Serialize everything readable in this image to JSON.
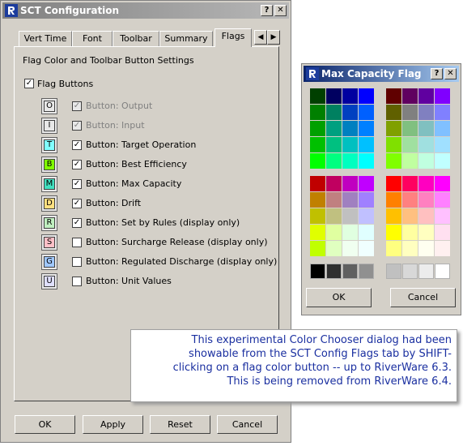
{
  "sct_window": {
    "title": "SCT Configuration",
    "help_btn": "?",
    "close_btn": "✕",
    "tabs": [
      "Vert Time",
      "Font",
      "Toolbar",
      "Summary",
      "Flags"
    ],
    "selected_tab": "Flags",
    "tab_scroll_left": "◀",
    "tab_scroll_right": "▶",
    "section_title": "Flag Color and Toolbar Button Settings",
    "flag_buttons_label": "Flag Buttons",
    "flag_buttons_checked": true,
    "flags": [
      {
        "letter": "O",
        "color": "#e8e8e8",
        "label": "Button: Output",
        "checked": true,
        "disabled": true
      },
      {
        "letter": "I",
        "color": "#e8e8e8",
        "label": "Button: Input",
        "checked": true,
        "disabled": true
      },
      {
        "letter": "T",
        "color": "#80ffff",
        "label": "Button: Target Operation",
        "checked": true,
        "disabled": false
      },
      {
        "letter": "B",
        "color": "#80ff00",
        "label": "Button: Best Efficiency",
        "checked": true,
        "disabled": false
      },
      {
        "letter": "M",
        "color": "#40e0c0",
        "label": "Button: Max Capacity",
        "checked": true,
        "disabled": false
      },
      {
        "letter": "D",
        "color": "#ffe080",
        "label": "Button: Drift",
        "checked": true,
        "disabled": false
      },
      {
        "letter": "R",
        "color": "#c0f0c0",
        "label": "Button: Set by Rules (display only)",
        "checked": true,
        "disabled": false
      },
      {
        "letter": "S",
        "color": "#ffc0c8",
        "label": "Button: Surcharge Release (display only)",
        "checked": false,
        "disabled": false
      },
      {
        "letter": "G",
        "color": "#a0c8ff",
        "label": "Button: Regulated Discharge (display only)",
        "checked": false,
        "disabled": false
      },
      {
        "letter": "U",
        "color": "#e0e0ff",
        "label": "Button: Unit Values",
        "checked": false,
        "disabled": false
      }
    ],
    "ok_label": "OK",
    "apply_label": "Apply",
    "reset_label": "Reset",
    "cancel_label": "Cancel"
  },
  "color_dialog": {
    "title": "Max Capacity Flag",
    "help_btn": "?",
    "close_btn": "✕",
    "ok_label": "OK",
    "cancel_label": "Cancel",
    "palettes": [
      [
        "#004000",
        "#000060",
        "#0000a0",
        "#0000ff",
        "#008000",
        "#008060",
        "#0040c0",
        "#0060ff",
        "#00a000",
        "#00a080",
        "#0080c0",
        "#0080ff",
        "#00c000",
        "#00c080",
        "#00c0c0",
        "#00c0ff",
        "#00ff00",
        "#00ff80",
        "#00ffc0",
        "#00ffff"
      ],
      [
        "#600000",
        "#600060",
        "#6000a0",
        "#8000ff",
        "#606000",
        "#808080",
        "#8080c0",
        "#8080ff",
        "#80a000",
        "#80c080",
        "#80c0c0",
        "#80c0ff",
        "#80e000",
        "#a0e0a0",
        "#a0e0e0",
        "#a0e0ff",
        "#80ff00",
        "#c0ffa0",
        "#c0ffe0",
        "#c0ffff"
      ],
      [
        "#c00000",
        "#c00060",
        "#c000c0",
        "#c000ff",
        "#c08000",
        "#c08080",
        "#a080c0",
        "#a080ff",
        "#c0c000",
        "#c0c080",
        "#c0c0c0",
        "#c0c0ff",
        "#e0ff00",
        "#e0ffa0",
        "#e0ffe0",
        "#e0ffff",
        "#c0ff00",
        "#e0ffc0",
        "#f0fff0",
        "#f0ffff"
      ],
      [
        "#ff0000",
        "#ff0060",
        "#ff00c0",
        "#ff00ff",
        "#ff8000",
        "#ff8080",
        "#ff80c0",
        "#ff80ff",
        "#ffc000",
        "#ffc080",
        "#ffc0c0",
        "#ffc0ff",
        "#ffff00",
        "#ffffa0",
        "#ffffc0",
        "#ffe0f0",
        "#ffff80",
        "#ffffc0",
        "#fffff0",
        "#fff0f0"
      ]
    ],
    "grays": [
      "#000000",
      "#303030",
      "#606060",
      "#909090",
      "#c0c0c0",
      "#d8d8d8",
      "#ececec",
      "#ffffff"
    ]
  },
  "note": {
    "line1": "This experimental Color Chooser dialog had been",
    "line2": "showable from the SCT Config Flags tab by SHIFT-",
    "line3": "clicking on a flag color button -- up to RiverWare 6.3.",
    "line4": "This is being removed from RiverWare 6.4."
  }
}
